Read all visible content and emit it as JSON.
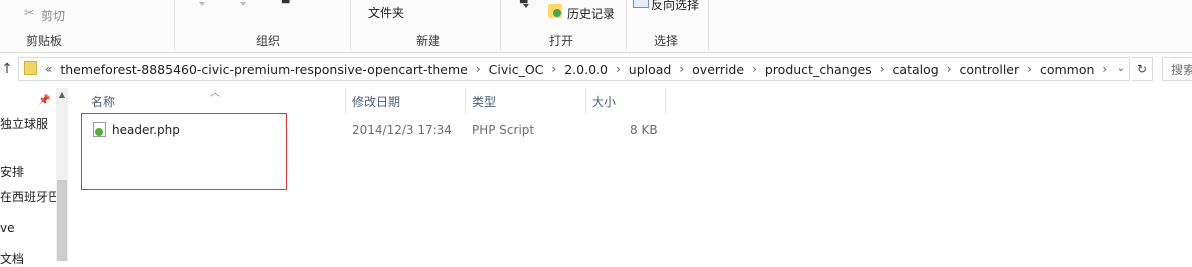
{
  "ribbon": {
    "clipboard": {
      "cut_label": "剪切",
      "group_label": "剪贴板"
    },
    "organize": {
      "group_label": "组织"
    },
    "new": {
      "folder_label": "文件夹",
      "group_label": "新建"
    },
    "open": {
      "history_label": "历史记录",
      "group_label": "打开"
    },
    "select": {
      "invert_label": "反向选择",
      "group_label": "选择"
    }
  },
  "address": {
    "overflow_label": "«",
    "crumbs": [
      "themeforest-8885460-civic-premium-responsive-opencart-theme",
      "Civic_OC",
      "2.0.0.0",
      "upload",
      "override",
      "product_changes",
      "catalog",
      "controller",
      "common"
    ],
    "search_placeholder": "搜索"
  },
  "nav": {
    "items": [
      "独立球服",
      "安排",
      "在西班牙巴",
      "ve",
      "文档"
    ]
  },
  "filelist": {
    "columns": {
      "name": "名称",
      "modified": "修改日期",
      "type": "类型",
      "size": "大小"
    },
    "rows": [
      {
        "name": "header.php",
        "modified": "2014/12/3 17:34",
        "type": "PHP Script",
        "size": "8 KB"
      }
    ]
  },
  "colors": {
    "highlight_border": "#d93b3b",
    "header_text": "#4c607a",
    "folder": "#f3d46a"
  }
}
